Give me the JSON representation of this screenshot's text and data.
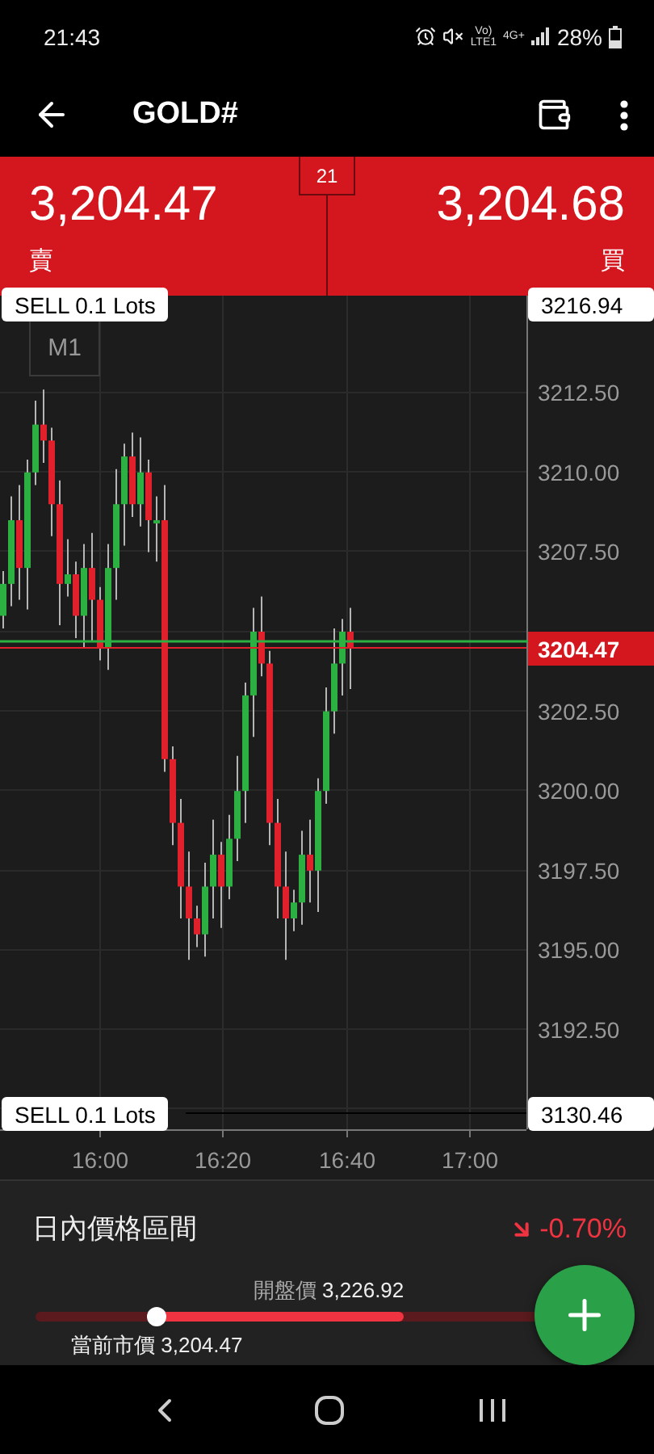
{
  "status_bar": {
    "time": "21:43",
    "volte": [
      "Vo)",
      "LTE1"
    ],
    "network": "4G+",
    "battery": "28%"
  },
  "app_bar": {
    "title": "GOLD#"
  },
  "quote": {
    "sell": {
      "price": "3,204.**47**",
      "label": "賣"
    },
    "spread": "21",
    "buy": {
      "price": "3,204.**68**",
      "label": "買"
    }
  },
  "chart": {
    "timeframe": "M1",
    "y_ticks": [
      "3212.50",
      "3210.00",
      "3207.50",
      "3202.50",
      "3200.00",
      "3197.50",
      "3195.00",
      "3192.50"
    ],
    "x_ticks": [
      "16:00",
      "16:20",
      "16:40",
      "17:00"
    ],
    "current_price": "3204.47",
    "orders": [
      {
        "label": "SELL 0.1 Lots",
        "price": "3216.94"
      },
      {
        "label": "SELL 0.1 Lots",
        "price": "3130.46"
      }
    ]
  },
  "day_range": {
    "title": "日內價格區間",
    "change": "-0.70%",
    "markers": [
      {
        "label": "開盤價",
        "value": "3,226.92"
      },
      {
        "label": "當前市價",
        "value": "3,204.47"
      }
    ]
  }
}
